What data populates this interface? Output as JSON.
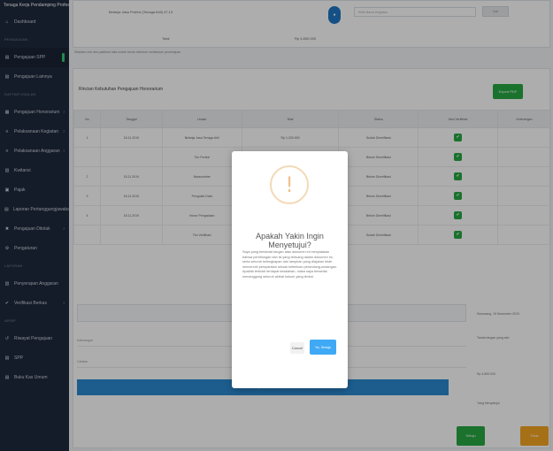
{
  "sidebar": {
    "brand": "Tenaga Kerja Pendamping Profesional",
    "items": [
      {
        "label": "Dashboard",
        "icon": "home-icon"
      },
      {
        "section": "Pengajuan"
      },
      {
        "label": "Pengajuan SPP",
        "icon": "doc-icon"
      },
      {
        "label": "Pengajuan Lainnya",
        "icon": "doc-icon"
      },
      {
        "section": "Daftar Usulan"
      },
      {
        "label": "Pengajuan Honorarium",
        "icon": "grid-icon"
      },
      {
        "label": "Pelaksanaan Kegiatan",
        "icon": "list-icon"
      },
      {
        "label": "Pelaksanaan Anggaran",
        "icon": "list-icon"
      },
      {
        "label": "Kwitansi",
        "icon": "receipt-icon"
      },
      {
        "label": "Pajak",
        "icon": "tax-icon"
      },
      {
        "label": "Laporan Pertanggungjawaban",
        "icon": "report-icon"
      },
      {
        "label": "Pengajuan Ditolak",
        "icon": "x-icon"
      },
      {
        "label": "Pengaturan",
        "icon": "gear-icon"
      },
      {
        "section": "Laporan"
      },
      {
        "label": "Penyerapan Anggaran",
        "icon": "chart-icon"
      },
      {
        "label": "Verifikasi Berkas",
        "icon": "check-icon"
      },
      {
        "section": "Arsip"
      },
      {
        "label": "Riwayat Pengajuan",
        "icon": "history-icon"
      },
      {
        "label": "SPP",
        "icon": "doc-icon"
      },
      {
        "label": "Buku Kas Umum",
        "icon": "book-icon"
      }
    ]
  },
  "topcard": {
    "line1": "Belanja Jasa Profesi (Tenaga Ahli) 47,13",
    "total_label": "Total",
    "total_value": "Rp 4.800.000",
    "search_placeholder": "Ketik Nama Kegiatan",
    "search_button": "Cari"
  },
  "note": "Silahkan cek dan pastikan data sudah benar sebelum melakukan persetujuan",
  "panel": {
    "title": "Rincian Kebutuhan Pengajuan Honorarium",
    "export_label": "Export PDF",
    "columns": [
      "No",
      "Tanggal",
      "Uraian",
      "Nilai",
      "Status",
      "Aksi Verifikasi",
      "Keterangan"
    ],
    "rows": [
      {
        "no": "1",
        "tanggal": "18.11.2019",
        "uraian": "Belanja Jasa Tenaga Ahli",
        "nilai": "Rp 1.200.000",
        "status": "Sudah Diverifikasi"
      },
      {
        "no": "",
        "tanggal": "",
        "uraian": "Tim Penilai",
        "nilai": "",
        "status": "Belum Diverifikasi"
      },
      {
        "no": "2",
        "tanggal": "18.11.2019",
        "uraian": "Narasumber",
        "nilai": "",
        "status": "Belum Diverifikasi"
      },
      {
        "no": "3",
        "tanggal": "18.11.2019",
        "uraian": "Pengolah Data",
        "nilai": "",
        "status": "Belum Diverifikasi"
      },
      {
        "no": "4",
        "tanggal": "18.11.2019",
        "uraian": "Honor Pengadaan",
        "nilai": "",
        "status": "Belum Diverifikasi"
      },
      {
        "no": "",
        "tanggal": "",
        "uraian": "Tim Verifikasi",
        "nilai": "",
        "status": "Sudah Diverifikasi"
      }
    ],
    "date_label": "Semarang, 19 November 2019",
    "signature_label": "Tanda tangan yang sah",
    "field1_label": "Keterangan",
    "field2_label": "Catatan",
    "amount_label": "Rp 4.800.000",
    "approver_label": "Yang Menyetujui",
    "submit_label": "Simpan Data",
    "approve_button": "Setuju",
    "reject_button": "Tolak"
  },
  "modal": {
    "title": "Apakah Yakin Ingin Menyetujui?",
    "body": "Saya yang bertanda tangan atas dokumen ini menyatakan bahwa perhitungan dan isi yang tertuang dalam dokumen ini, serta seluruh kelengkapan dan lampiran yang diajukan telah memenuhi persyaratan sesuai ketentuan perundang-undangan. Apabila terbukti terdapat kesalahan, maka saya bersedia menanggung seluruh akibat hukum yang timbul.",
    "cancel_label": "Cancel",
    "confirm_label": "Ya, Setuju"
  },
  "colors": {
    "sidebar_bg": "#1f2a3d",
    "accent_green": "#27a843",
    "accent_blue": "#2a89d0",
    "confirm_blue": "#3fa9f5",
    "warning_orange": "#f0c28f",
    "reject_orange": "#f5a623"
  }
}
